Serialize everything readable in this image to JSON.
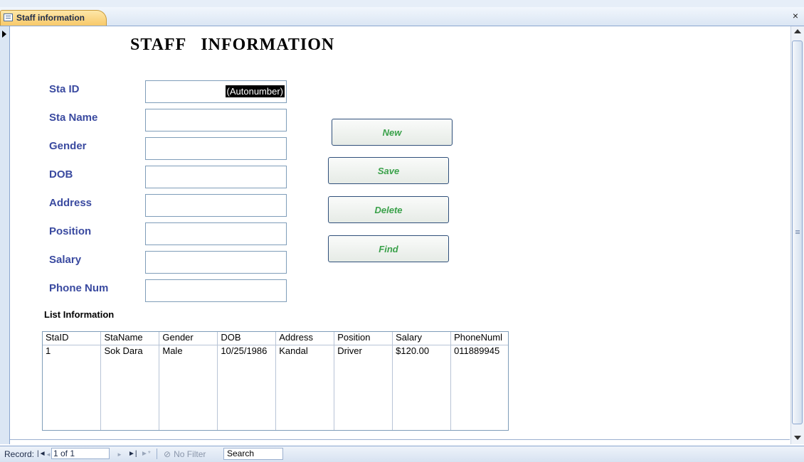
{
  "tab": {
    "title": "Staff information",
    "close_glyph": "×"
  },
  "form": {
    "title": "STAFF   INFORMATION",
    "fields": [
      {
        "label": "Sta ID",
        "value": "(Autonumber)"
      },
      {
        "label": "Sta Name",
        "value": ""
      },
      {
        "label": "Gender",
        "value": ""
      },
      {
        "label": "DOB",
        "value": ""
      },
      {
        "label": "Address",
        "value": ""
      },
      {
        "label": "Position",
        "value": ""
      },
      {
        "label": "Salary",
        "value": ""
      },
      {
        "label": "Phone Num",
        "value": ""
      }
    ],
    "buttons": {
      "new": "New",
      "save": "Save",
      "delete": "Delete",
      "find": "Find"
    },
    "list": {
      "heading": "List Information",
      "columns": [
        "StaID",
        "StaName",
        "Gender",
        "DOB",
        "Address",
        "Position",
        "Salary",
        "PhoneNuml"
      ],
      "rows": [
        [
          "1",
          "Sok Dara",
          "Male",
          "10/25/1986",
          "Kandal",
          "Driver",
          "$120.00",
          "011889945"
        ]
      ]
    }
  },
  "nav": {
    "record_label": "Record:",
    "first_glyph": "|◄",
    "prev_glyph": "◄",
    "position": "1 of 1",
    "next_glyph": "►",
    "last_glyph": "►|",
    "new_glyph": "►*",
    "filter_label": "No Filter",
    "search_label": "Search"
  },
  "colors": {
    "label": "#3a4aa0",
    "button_text": "#3aa14a",
    "tab": "#f8c96a"
  }
}
